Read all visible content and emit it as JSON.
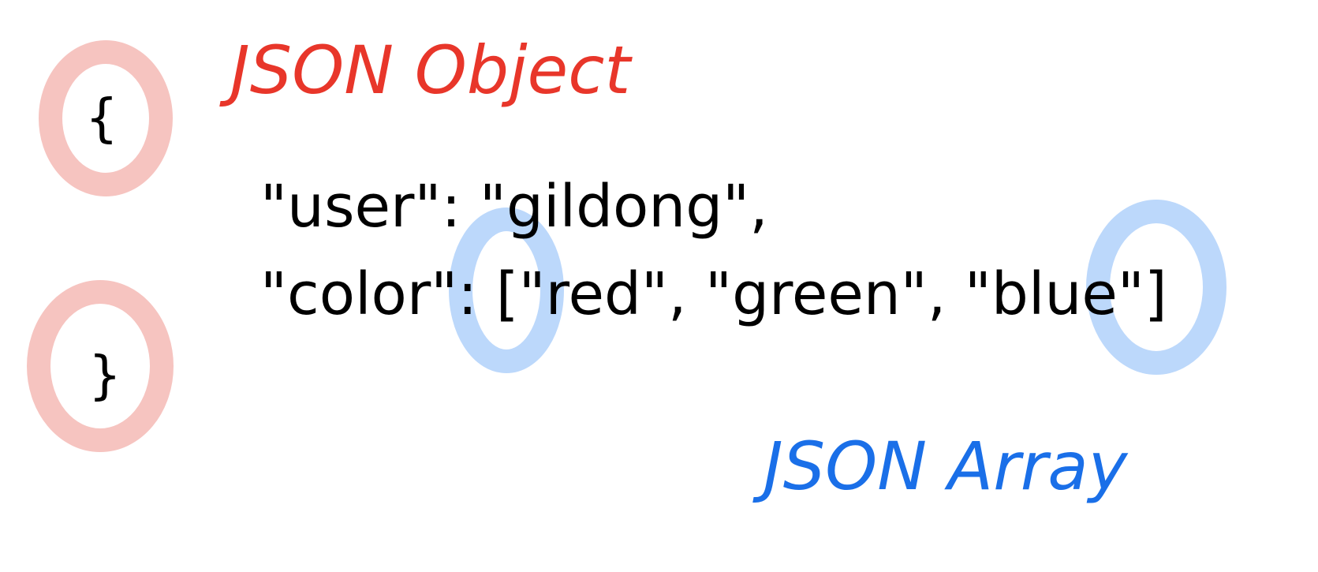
{
  "labels": {
    "object_label": "JSON Object",
    "array_label": "JSON Array"
  },
  "code": {
    "open_brace": "{",
    "close_brace": "}",
    "line1": "\"user\": \"gildong\",",
    "line2": "\"color\": [\"red\", \"green\", \"blue\"]"
  },
  "colors": {
    "object_label": "#e8362a",
    "array_label": "#1a6fe8",
    "object_highlight": "#f6c4c0",
    "array_highlight": "#bcd8fb",
    "text": "#000000"
  }
}
